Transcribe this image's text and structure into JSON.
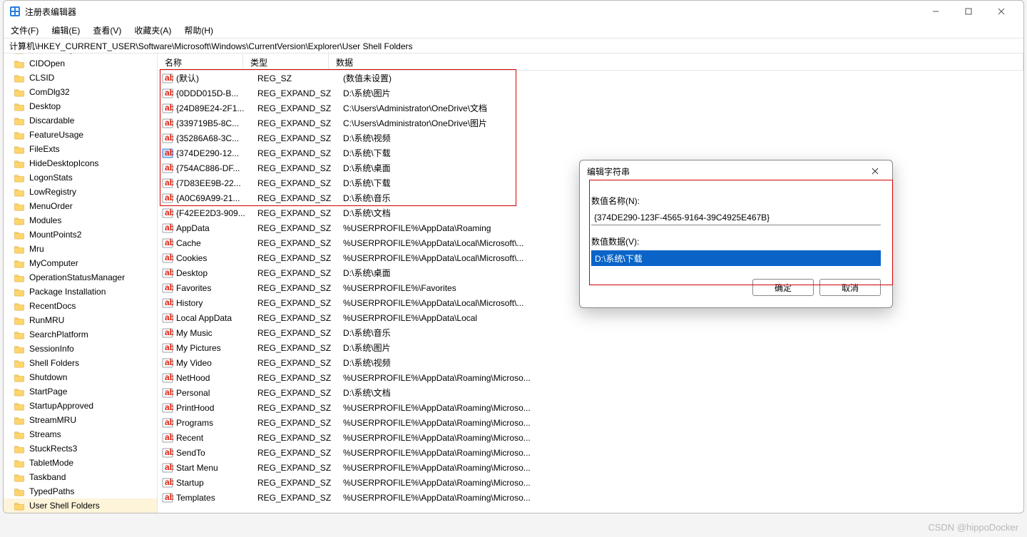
{
  "window": {
    "title": "注册表编辑器"
  },
  "menu": [
    "文件(F)",
    "编辑(E)",
    "查看(V)",
    "收藏夹(A)",
    "帮助(H)"
  ],
  "address": "计算机\\HKEY_CURRENT_USER\\Software\\Microsoft\\Windows\\CurrentVersion\\Explorer\\User Shell Folders",
  "tree": [
    {
      "label": "CD Burning"
    },
    {
      "label": "CIDOpen"
    },
    {
      "label": "CLSID"
    },
    {
      "label": "ComDlg32"
    },
    {
      "label": "Desktop"
    },
    {
      "label": "Discardable"
    },
    {
      "label": "FeatureUsage"
    },
    {
      "label": "FileExts"
    },
    {
      "label": "HideDesktopIcons"
    },
    {
      "label": "LogonStats"
    },
    {
      "label": "LowRegistry"
    },
    {
      "label": "MenuOrder"
    },
    {
      "label": "Modules"
    },
    {
      "label": "MountPoints2"
    },
    {
      "label": "Mru"
    },
    {
      "label": "MyComputer"
    },
    {
      "label": "OperationStatusManager"
    },
    {
      "label": "Package Installation"
    },
    {
      "label": "RecentDocs"
    },
    {
      "label": "RunMRU"
    },
    {
      "label": "SearchPlatform"
    },
    {
      "label": "SessionInfo"
    },
    {
      "label": "Shell Folders"
    },
    {
      "label": "Shutdown"
    },
    {
      "label": "StartPage"
    },
    {
      "label": "StartupApproved"
    },
    {
      "label": "StreamMRU"
    },
    {
      "label": "Streams"
    },
    {
      "label": "StuckRects3"
    },
    {
      "label": "TabletMode"
    },
    {
      "label": "Taskband"
    },
    {
      "label": "TypedPaths"
    },
    {
      "label": "User Shell Folders",
      "selected": true
    }
  ],
  "columns": {
    "name": "名称",
    "type": "类型",
    "data": "数据"
  },
  "values": [
    {
      "name": "(默认)",
      "type": "REG_SZ",
      "data": "(数值未设置)",
      "sel": false
    },
    {
      "name": "{0DDD015D-B...",
      "type": "REG_EXPAND_SZ",
      "data": "D:\\系统\\图片"
    },
    {
      "name": "{24D89E24-2F1...",
      "type": "REG_EXPAND_SZ",
      "data": "C:\\Users\\Administrator\\OneDrive\\文档"
    },
    {
      "name": "{339719B5-8C...",
      "type": "REG_EXPAND_SZ",
      "data": "C:\\Users\\Administrator\\OneDrive\\图片"
    },
    {
      "name": "{35286A68-3C...",
      "type": "REG_EXPAND_SZ",
      "data": "D:\\系统\\视频"
    },
    {
      "name": "{374DE290-12...",
      "type": "REG_EXPAND_SZ",
      "data": "D:\\系统\\下载",
      "sel": true
    },
    {
      "name": "{754AC886-DF...",
      "type": "REG_EXPAND_SZ",
      "data": "D:\\系统\\桌面"
    },
    {
      "name": "{7D83EE9B-22...",
      "type": "REG_EXPAND_SZ",
      "data": "D:\\系统\\下载"
    },
    {
      "name": "{A0C69A99-21...",
      "type": "REG_EXPAND_SZ",
      "data": "D:\\系统\\音乐"
    },
    {
      "name": "{F42EE2D3-909...",
      "type": "REG_EXPAND_SZ",
      "data": "D:\\系统\\文档"
    },
    {
      "name": "AppData",
      "type": "REG_EXPAND_SZ",
      "data": "%USERPROFILE%\\AppData\\Roaming"
    },
    {
      "name": "Cache",
      "type": "REG_EXPAND_SZ",
      "data": "%USERPROFILE%\\AppData\\Local\\Microsoft\\..."
    },
    {
      "name": "Cookies",
      "type": "REG_EXPAND_SZ",
      "data": "%USERPROFILE%\\AppData\\Local\\Microsoft\\..."
    },
    {
      "name": "Desktop",
      "type": "REG_EXPAND_SZ",
      "data": "D:\\系统\\桌面"
    },
    {
      "name": "Favorites",
      "type": "REG_EXPAND_SZ",
      "data": "%USERPROFILE%\\Favorites"
    },
    {
      "name": "History",
      "type": "REG_EXPAND_SZ",
      "data": "%USERPROFILE%\\AppData\\Local\\Microsoft\\..."
    },
    {
      "name": "Local AppData",
      "type": "REG_EXPAND_SZ",
      "data": "%USERPROFILE%\\AppData\\Local"
    },
    {
      "name": "My Music",
      "type": "REG_EXPAND_SZ",
      "data": "D:\\系统\\音乐"
    },
    {
      "name": "My Pictures",
      "type": "REG_EXPAND_SZ",
      "data": "D:\\系统\\图片"
    },
    {
      "name": "My Video",
      "type": "REG_EXPAND_SZ",
      "data": "D:\\系统\\视频"
    },
    {
      "name": "NetHood",
      "type": "REG_EXPAND_SZ",
      "data": "%USERPROFILE%\\AppData\\Roaming\\Microso..."
    },
    {
      "name": "Personal",
      "type": "REG_EXPAND_SZ",
      "data": "D:\\系统\\文档"
    },
    {
      "name": "PrintHood",
      "type": "REG_EXPAND_SZ",
      "data": "%USERPROFILE%\\AppData\\Roaming\\Microso..."
    },
    {
      "name": "Programs",
      "type": "REG_EXPAND_SZ",
      "data": "%USERPROFILE%\\AppData\\Roaming\\Microso..."
    },
    {
      "name": "Recent",
      "type": "REG_EXPAND_SZ",
      "data": "%USERPROFILE%\\AppData\\Roaming\\Microso..."
    },
    {
      "name": "SendTo",
      "type": "REG_EXPAND_SZ",
      "data": "%USERPROFILE%\\AppData\\Roaming\\Microso..."
    },
    {
      "name": "Start Menu",
      "type": "REG_EXPAND_SZ",
      "data": "%USERPROFILE%\\AppData\\Roaming\\Microso..."
    },
    {
      "name": "Startup",
      "type": "REG_EXPAND_SZ",
      "data": "%USERPROFILE%\\AppData\\Roaming\\Microso..."
    },
    {
      "name": "Templates",
      "type": "REG_EXPAND_SZ",
      "data": "%USERPROFILE%\\AppData\\Roaming\\Microso..."
    }
  ],
  "dialog": {
    "title": "编辑字符串",
    "name_label": "数值名称(N):",
    "name_value": "{374DE290-123F-4565-9164-39C4925E467B}",
    "data_label": "数值数据(V):",
    "data_value": "D:\\系统\\下载",
    "ok": "确定",
    "cancel": "取消"
  },
  "watermark": "CSDN @hippoDocker"
}
